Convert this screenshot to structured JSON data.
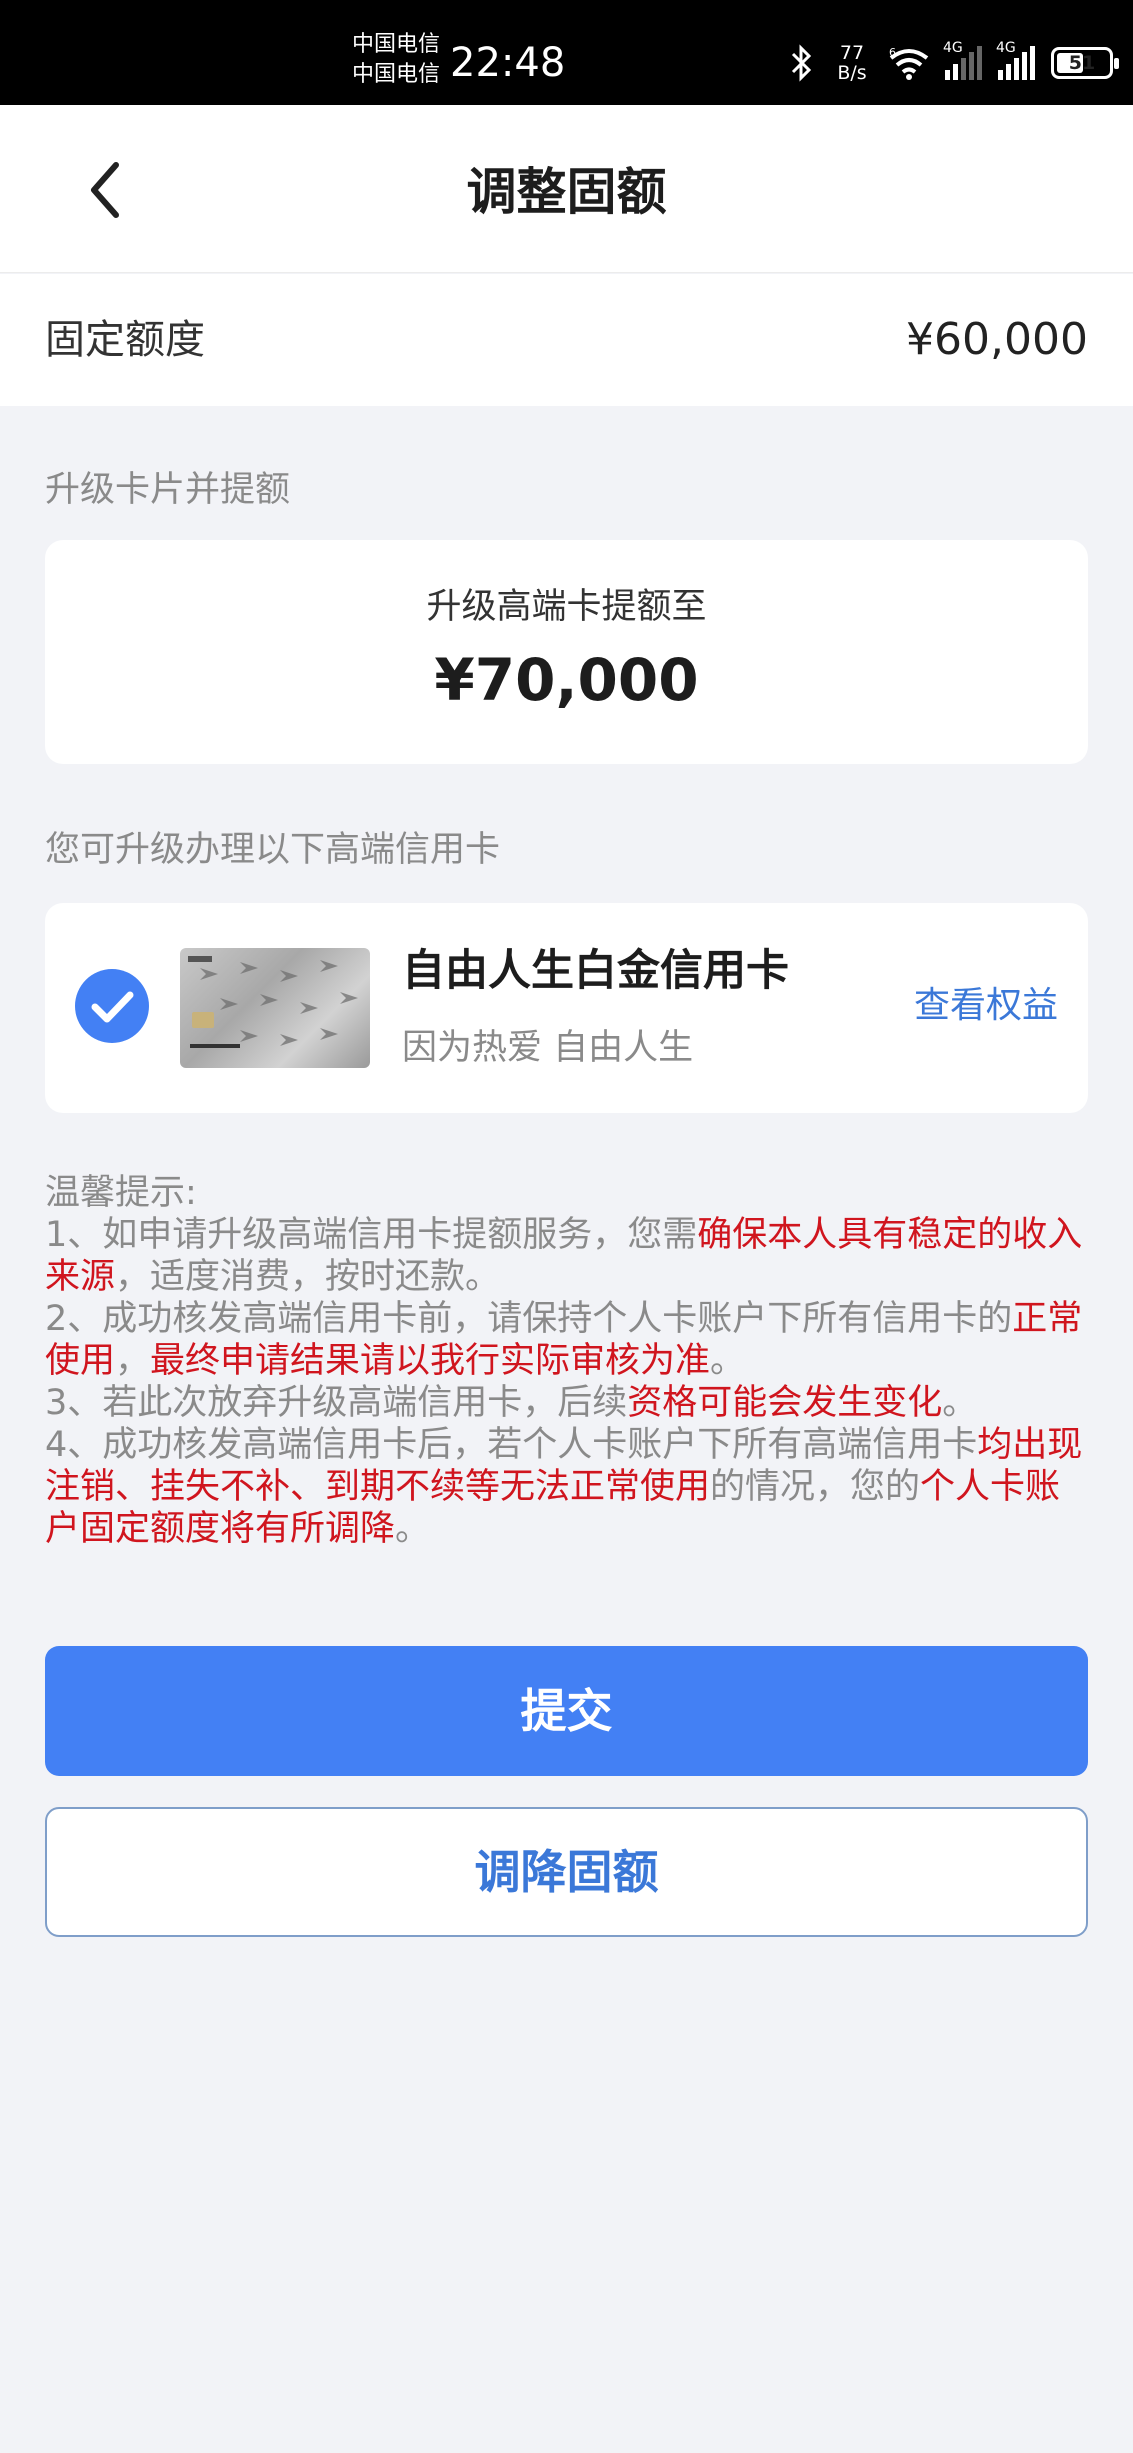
{
  "status_bar": {
    "carrier_1": "中国电信",
    "carrier_2": "中国电信",
    "time": "22:48",
    "net_speed_value": "77",
    "net_speed_unit": "B/s",
    "wifi_tag": "6",
    "signal_1_tag": "4G",
    "signal_2_tag": "4G",
    "battery": "51",
    "battery_level_percent": 51
  },
  "nav": {
    "title": "调整固额"
  },
  "fixed_limit": {
    "label": "固定额度",
    "value": "¥60,000"
  },
  "upgrade_section": {
    "label": "升级卡片并提额",
    "title": "升级高端卡提额至",
    "amount": "¥70,000"
  },
  "card_section": {
    "label": "您可升级办理以下高端信用卡",
    "card": {
      "name": "自由人生白金信用卡",
      "slogan": "因为热爱 自由人生",
      "benefits_link": "查看权益",
      "selected": true
    }
  },
  "tips": {
    "heading": "温馨提示:",
    "t1_a": "1、如申请升级高端信用卡提额服务，您需",
    "t1_b": "确保本人具有稳定的收入来源",
    "t1_c": "，适度消费，按时还款。",
    "t2_a": "2、成功核发高端信用卡前，请保持个人卡账户下所有信用卡的",
    "t2_b": "正常使用",
    "t2_c": "，",
    "t2_d": "最终申请结果请以我行实际审核为准",
    "t2_e": "。",
    "t3_a": "3、若此次放弃升级高端信用卡，后续",
    "t3_b": "资格可能会发生变化",
    "t3_c": "。",
    "t4_a": "4、成功核发高端信用卡后，若个人卡账户下所有高端信用卡",
    "t4_b": "均出现注销、挂失不补、到期不续等无法正常使用",
    "t4_c": "的情况，您的",
    "t4_d": "个人卡账户固定额度将有所调降",
    "t4_e": "。"
  },
  "buttons": {
    "submit": "提交",
    "reduce": "调降固额"
  },
  "colors": {
    "primary": "#4380f4",
    "link": "#3b78d8",
    "warning": "#d0151e",
    "background": "#f2f3f7"
  }
}
